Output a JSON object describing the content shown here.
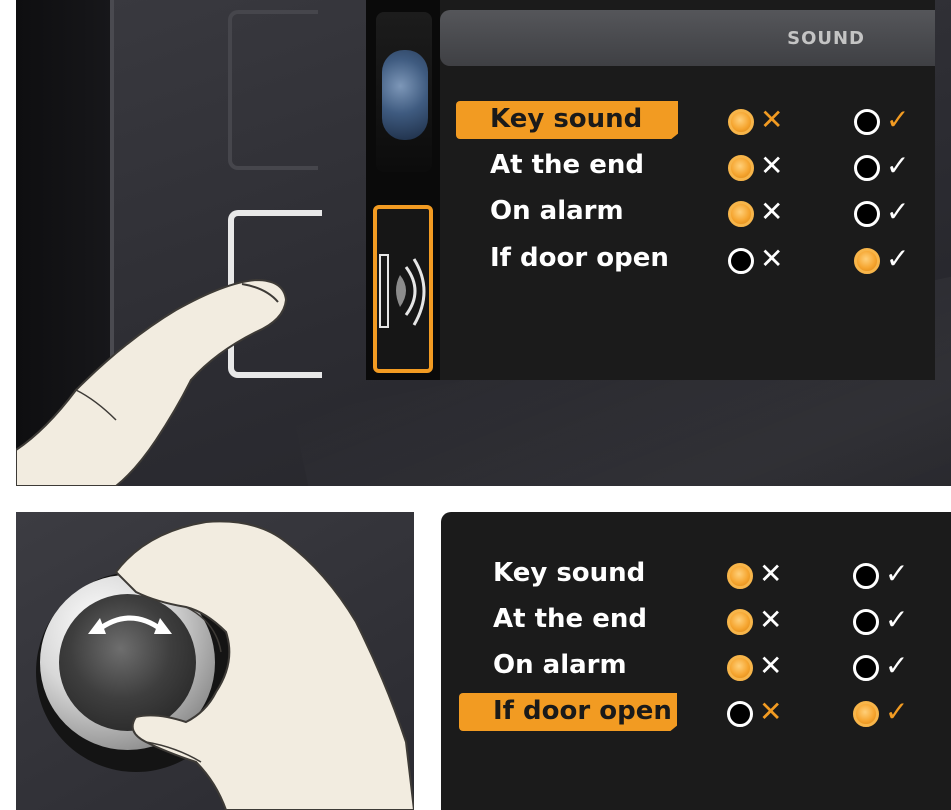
{
  "top_screen": {
    "title": "SOUND",
    "rows": [
      {
        "label": "Key sound",
        "selected": true,
        "no_on": true,
        "yes_on": false
      },
      {
        "label": "At the end",
        "selected": false,
        "no_on": true,
        "yes_on": false
      },
      {
        "label": "On alarm",
        "selected": false,
        "no_on": true,
        "yes_on": false
      },
      {
        "label": "If door open",
        "selected": false,
        "no_on": false,
        "yes_on": true
      }
    ]
  },
  "bottom_screen": {
    "rows": [
      {
        "label": "Key sound",
        "selected": false,
        "no_on": true,
        "yes_on": false
      },
      {
        "label": "At the end",
        "selected": false,
        "no_on": true,
        "yes_on": false
      },
      {
        "label": "On alarm",
        "selected": false,
        "no_on": true,
        "yes_on": false
      },
      {
        "label": "If door open",
        "selected": true,
        "no_on": false,
        "yes_on": true
      }
    ]
  },
  "marks": {
    "no": "✕",
    "yes": "✓"
  },
  "colors": {
    "accent": "#f29b22",
    "screen_bg": "#1b1b1b",
    "text": "#ffffff"
  },
  "icons": [
    "globe-icon",
    "sound-icon",
    "rotate-icon"
  ]
}
